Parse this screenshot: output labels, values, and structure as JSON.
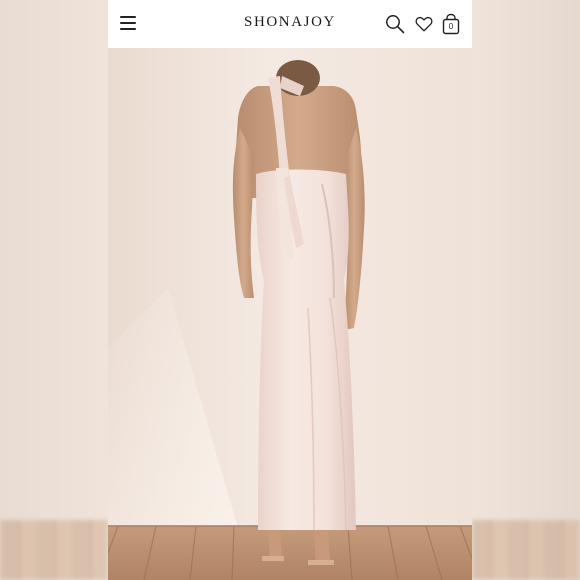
{
  "header": {
    "brand": "SHONAJOY",
    "cart_count": "0"
  },
  "icons": {
    "menu": "hamburger-menu-icon",
    "search": "search-icon",
    "wishlist": "heart-icon",
    "cart": "shopping-bag-icon"
  },
  "colors": {
    "header_bg": "#ffffff",
    "icon": "#222222",
    "wall": "#f2e6dd",
    "dress": "#f4e3dc",
    "floor": "#c9a283"
  },
  "main": {
    "image": "product-photo"
  }
}
